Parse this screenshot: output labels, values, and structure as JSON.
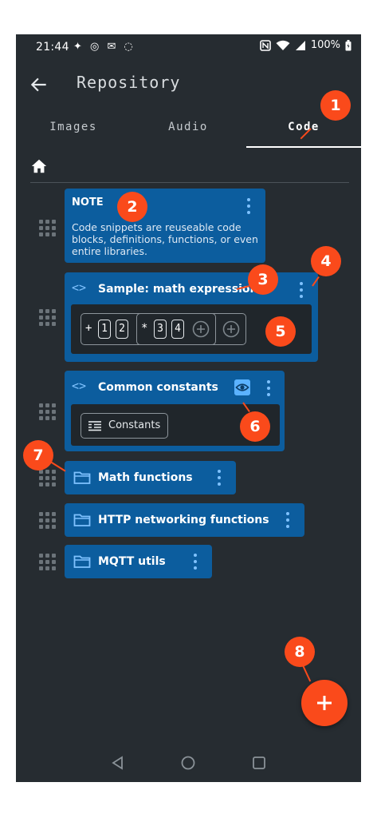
{
  "status_bar": {
    "time": "21:44",
    "app_icons": "✦ ◎ ✉ ◌",
    "battery": "100%"
  },
  "app_bar": {
    "title": "Repository",
    "back_icon": "arrow-left-icon"
  },
  "tabs": [
    {
      "label": "Images",
      "active": false
    },
    {
      "label": "Audio",
      "active": false
    },
    {
      "label": "Code",
      "active": true
    }
  ],
  "home_icon": "home-icon",
  "items": {
    "note": {
      "label": "NOTE",
      "text": "Code snippets are reuseable code blocks, definitions, functions, or even entire libraries."
    },
    "sample": {
      "title": "Sample: math expression",
      "expression": {
        "op1": "+",
        "digits1": [
          "1",
          "2"
        ],
        "op2": "*",
        "digits2": [
          "3",
          "4"
        ]
      }
    },
    "constants": {
      "title": "Common constants",
      "block_label": "Constants"
    },
    "folders": [
      {
        "label": "Math functions"
      },
      {
        "label": "HTTP networking functions"
      },
      {
        "label": "MQTT utils"
      }
    ]
  },
  "badges": [
    "1",
    "2",
    "3",
    "4",
    "5",
    "6",
    "7",
    "8"
  ],
  "colors": {
    "background": "#262c31",
    "card": "#0c5d9e",
    "badge": "#fa4a1b",
    "accent": "#7fc2ff"
  }
}
